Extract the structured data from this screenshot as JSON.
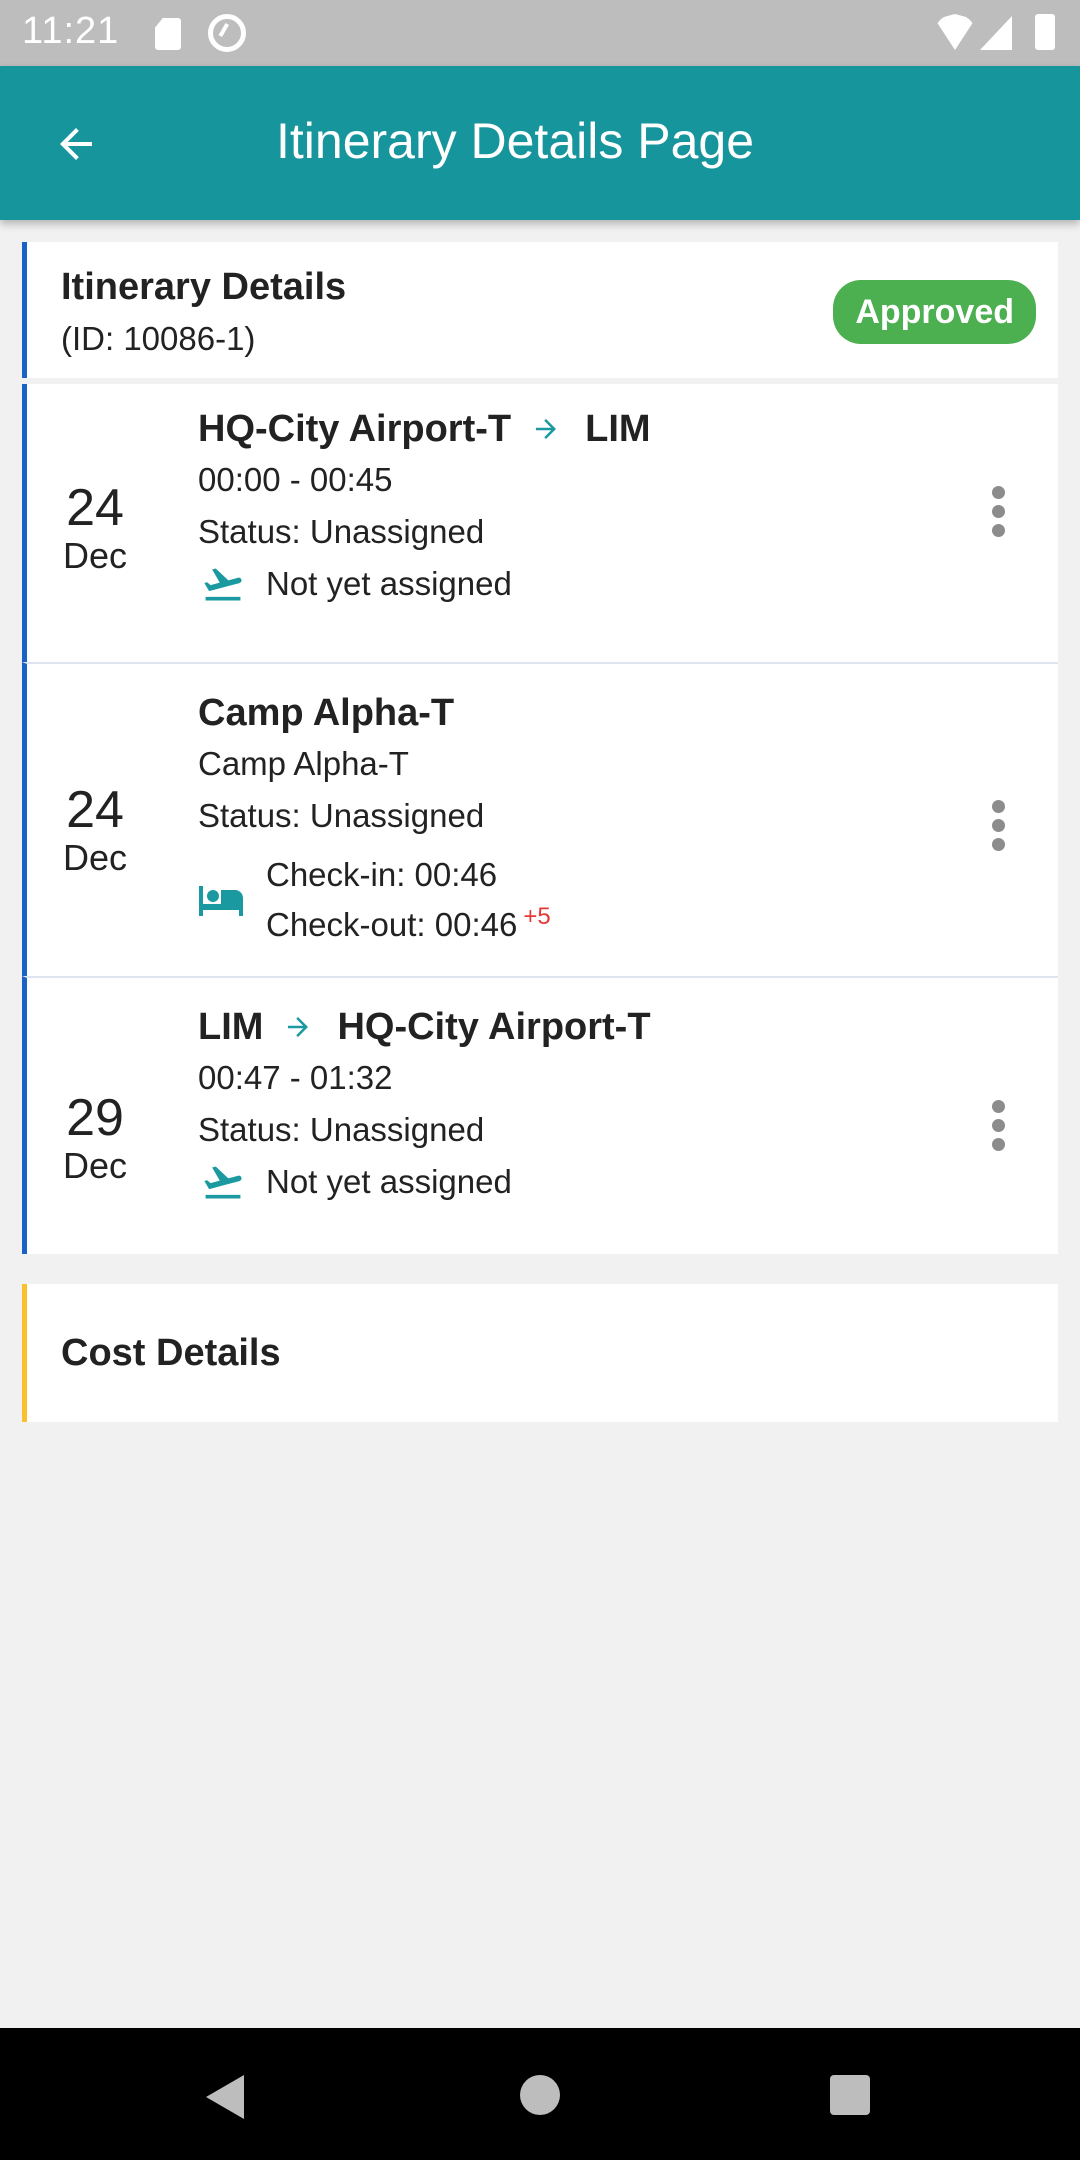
{
  "status_bar": {
    "time": "11:21"
  },
  "app_bar": {
    "title": "Itinerary Details Page",
    "back_icon": "arrow-back-icon"
  },
  "itinerary": {
    "title": "Itinerary Details",
    "id_text": "(ID: 10086-1)",
    "status_badge": "Approved",
    "accent_color": "#1a62c5",
    "badge_color": "#4caf50"
  },
  "segments": [
    {
      "type": "flight",
      "day": "24",
      "month": "Dec",
      "from": "HQ-City Airport-T",
      "to": "LIM",
      "time": "00:00 - 00:45",
      "status": "Status: Unassigned",
      "detail_icon": "flight-takeoff-icon",
      "detail": "Not yet assigned"
    },
    {
      "type": "accommodation",
      "day": "24",
      "month": "Dec",
      "title": "Camp Alpha-T",
      "subtitle": "Camp Alpha-T",
      "status": "Status: Unassigned",
      "detail_icon": "hotel-bed-icon",
      "check_in": "Check-in: 00:46",
      "check_out": "Check-out: 00:46",
      "extra": "+5"
    },
    {
      "type": "flight",
      "day": "29",
      "month": "Dec",
      "from": "LIM",
      "to": "HQ-City Airport-T",
      "time": "00:47 - 01:32",
      "status": "Status: Unassigned",
      "detail_icon": "flight-takeoff-icon",
      "detail": "Not yet assigned"
    }
  ],
  "cost": {
    "title": "Cost Details",
    "accent_color": "#fbc02d"
  },
  "colors": {
    "primary": "#17959c",
    "teal_icon": "#1a9aa0",
    "extra_red": "#e53935"
  }
}
